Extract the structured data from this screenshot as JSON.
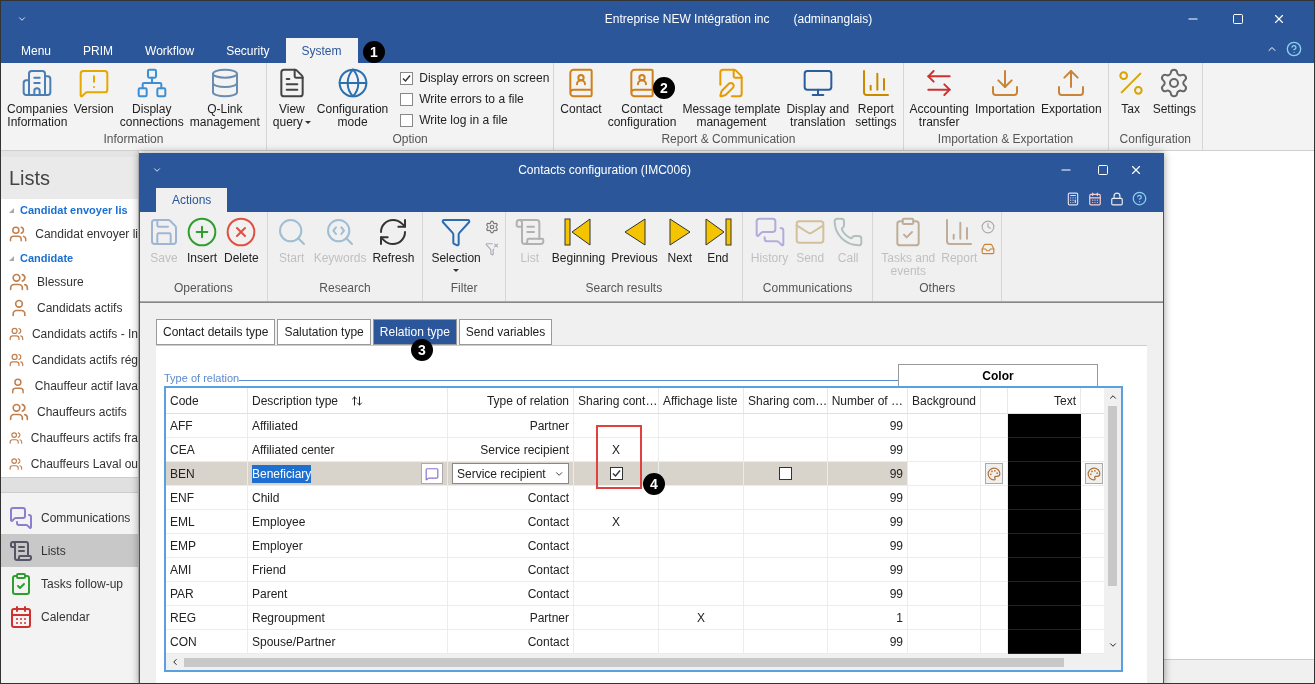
{
  "window": {
    "title": "Entreprise NEW Intégration inc",
    "user": "(adminanglais)"
  },
  "menu_tabs": [
    {
      "label": "Menu",
      "selected": false
    },
    {
      "label": "PRIM",
      "selected": false
    },
    {
      "label": "Workflow",
      "selected": false
    },
    {
      "label": "Security",
      "selected": false
    },
    {
      "label": "System",
      "selected": true
    }
  ],
  "ribbon_groups": [
    {
      "label": "Information",
      "items": [
        {
          "label": "Companies\nInformation"
        },
        {
          "label": "Version"
        },
        {
          "label": "Display\nconnections"
        },
        {
          "label": "Q-Link\nmanagement"
        }
      ]
    },
    {
      "label": "Option",
      "items": [
        {
          "label": "View\nquery",
          "dropdown": true
        },
        {
          "label": "Configuration\nmode"
        }
      ],
      "checks": [
        {
          "label": "Display errors on screen",
          "checked": true
        },
        {
          "label": "Write errors to a file",
          "checked": false
        },
        {
          "label": "Write log in a file",
          "checked": false
        }
      ]
    },
    {
      "label": "Report & Communication",
      "items": [
        {
          "label": "Contact"
        },
        {
          "label": "Contact\nconfiguration"
        },
        {
          "label": "Message template\nmanagement"
        },
        {
          "label": "Display and\ntranslation"
        },
        {
          "label": "Report\nsettings"
        }
      ]
    },
    {
      "label": "Importation & Exportation",
      "items": [
        {
          "label": "Accounting\ntransfer"
        },
        {
          "label": "Importation"
        },
        {
          "label": "Exportation"
        }
      ]
    },
    {
      "label": "Configuration",
      "items": [
        {
          "label": "Tax"
        },
        {
          "label": "Settings"
        }
      ]
    }
  ],
  "sidebar": {
    "title": "Lists",
    "groups": [
      {
        "label": "Candidat envoyer lis",
        "expanded": true,
        "children": [
          {
            "label": "Candidat envoyer li",
            "kind": "group"
          }
        ]
      },
      {
        "label": "Candidate",
        "expanded": true,
        "children": [
          {
            "label": "Blessure",
            "kind": "group"
          },
          {
            "label": "Candidats actifs",
            "kind": "single"
          },
          {
            "label": "Candidats actifs - In",
            "kind": "group"
          },
          {
            "label": "Candidats actifs rég",
            "kind": "group"
          },
          {
            "label": "Chauffeur actif lava",
            "kind": "single"
          },
          {
            "label": "Chauffeurs actifs",
            "kind": "group"
          },
          {
            "label": "Chauffeurs actifs fra",
            "kind": "group"
          },
          {
            "label": "Chauffeurs Laval ou",
            "kind": "group"
          }
        ]
      }
    ],
    "nav": [
      {
        "label": "Communications",
        "selected": false
      },
      {
        "label": "Lists",
        "selected": true
      },
      {
        "label": "Tasks follow-up",
        "selected": false
      },
      {
        "label": "Calendar",
        "selected": false
      }
    ]
  },
  "dialog": {
    "title": "Contacts configuration (IMC006)",
    "tabs": [
      {
        "label": "Actions",
        "selected": true
      }
    ],
    "toolbar_groups": [
      {
        "label": "Operations",
        "items": [
          {
            "label": "Save",
            "disabled": true
          },
          {
            "label": "Insert",
            "disabled": false
          },
          {
            "label": "Delete",
            "disabled": false
          }
        ]
      },
      {
        "label": "Research",
        "items": [
          {
            "label": "Start",
            "disabled": true
          },
          {
            "label": "Keywords",
            "disabled": true
          },
          {
            "label": "Refresh",
            "disabled": false
          }
        ]
      },
      {
        "label": "Filter",
        "items": [
          {
            "label": "Selection",
            "disabled": false,
            "dropdown": true
          }
        ]
      },
      {
        "label": "Search results",
        "items": [
          {
            "label": "List",
            "disabled": true
          },
          {
            "label": "Beginning",
            "disabled": false
          },
          {
            "label": "Previous",
            "disabled": false
          },
          {
            "label": "Next",
            "disabled": false
          },
          {
            "label": "End",
            "disabled": false
          }
        ]
      },
      {
        "label": "Communications",
        "items": [
          {
            "label": "History",
            "disabled": true
          },
          {
            "label": "Send",
            "disabled": true
          },
          {
            "label": "Call",
            "disabled": true
          }
        ]
      },
      {
        "label": "Others",
        "items": [
          {
            "label": "Tasks and\nevents",
            "disabled": true
          },
          {
            "label": "Report",
            "disabled": true
          }
        ]
      }
    ],
    "sub_tabs": [
      {
        "label": "Contact details type",
        "selected": false
      },
      {
        "label": "Salutation type",
        "selected": false
      },
      {
        "label": "Relation type",
        "selected": true
      },
      {
        "label": "Send variables",
        "selected": false
      }
    ],
    "section_title": "Type of relation",
    "color_header": "Color",
    "columns": [
      "Code",
      "Description type",
      "Type of relation",
      "Sharing cont…",
      "Affichage liste",
      "Sharing com…",
      "Number of …",
      "Background",
      "Text"
    ],
    "rows": [
      {
        "code": "AFF",
        "description": "Affiliated",
        "relation": "Partner",
        "number": "99",
        "color": "#000000",
        "selected": false
      },
      {
        "code": "CEA",
        "description": "Affiliated center",
        "relation": "Service recipient",
        "sharing_contact": "X",
        "number": "99",
        "color": "#000000",
        "selected": false
      },
      {
        "code": "BEN",
        "description": "Beneficiary",
        "relation": "Service recipient",
        "sharing_contact_checked": true,
        "sharing_com_checked": false,
        "number": "99",
        "color": "#000000",
        "selected": true
      },
      {
        "code": "ENF",
        "description": "Child",
        "relation": "Contact",
        "number": "99",
        "color": "#000000",
        "selected": false
      },
      {
        "code": "EML",
        "description": "Employee",
        "relation": "Contact",
        "sharing_contact": "X",
        "number": "99",
        "color": "#000000",
        "selected": false
      },
      {
        "code": "EMP",
        "description": "Employer",
        "relation": "Contact",
        "number": "99",
        "color": "#000000",
        "selected": false
      },
      {
        "code": "AMI",
        "description": "Friend",
        "relation": "Contact",
        "number": "99",
        "color": "#000000",
        "selected": false
      },
      {
        "code": "PAR",
        "description": "Parent",
        "relation": "Contact",
        "number": "99",
        "color": "#000000",
        "selected": false
      },
      {
        "code": "REG",
        "description": "Regroupment",
        "relation": "Partner",
        "affichage": "X",
        "number": "1",
        "color": "#000000",
        "selected": false
      },
      {
        "code": "CON",
        "description": "Spouse/Partner",
        "relation": "Contact",
        "number": "99",
        "color": "#000000",
        "selected": false
      }
    ]
  },
  "callouts": [
    "1",
    "2",
    "3",
    "4"
  ]
}
